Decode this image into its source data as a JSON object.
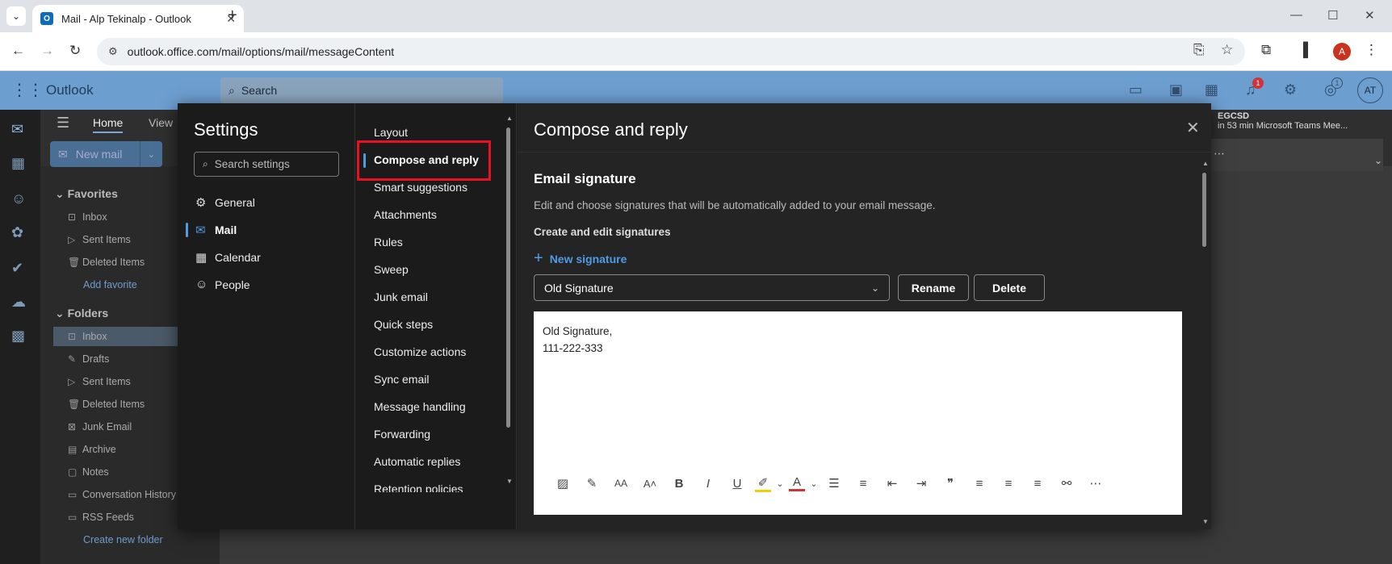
{
  "browser": {
    "tab_title": "Mail - Alp Tekinalp - Outlook",
    "tab_close": "✕",
    "new_tab": "+",
    "url": "outlook.office.com/mail/options/mail/messageContent",
    "profile_initial": "A"
  },
  "outlook_header": {
    "brand": "Outlook",
    "search_placeholder": "Search",
    "notification_badge": "1",
    "tips_badge": "1",
    "avatar_initials": "AT"
  },
  "ribbon": {
    "tabs": [
      "Home",
      "View"
    ],
    "new_mail_label": "New mail"
  },
  "folder_pane": {
    "favorites_label": "Favorites",
    "favorites": [
      "Inbox",
      "Sent Items",
      "Deleted Items"
    ],
    "add_favorite": "Add favorite",
    "folders_label": "Folders",
    "folders": [
      "Inbox",
      "Drafts",
      "Sent Items",
      "Deleted Items",
      "Junk Email",
      "Archive",
      "Notes",
      "Conversation History",
      "RSS Feeds"
    ],
    "create_folder": "Create new folder"
  },
  "meeting": {
    "title": "EGCSD",
    "subtitle": "in 53 min Microsoft Teams Mee..."
  },
  "settings": {
    "title": "Settings",
    "search_placeholder": "Search settings",
    "nav": [
      "General",
      "Mail",
      "Calendar",
      "People"
    ],
    "sub_nav": [
      "Layout",
      "Compose and reply",
      "Smart suggestions",
      "Attachments",
      "Rules",
      "Sweep",
      "Junk email",
      "Quick steps",
      "Customize actions",
      "Sync email",
      "Message handling",
      "Forwarding",
      "Automatic replies",
      "Retention policies"
    ]
  },
  "content": {
    "title": "Compose and reply",
    "section_title": "Email signature",
    "description": "Edit and choose signatures that will be automatically added to your email message.",
    "sub_title": "Create and edit signatures",
    "new_signature": "New signature",
    "selected_signature": "Old Signature",
    "rename_label": "Rename",
    "delete_label": "Delete",
    "signature_lines": [
      "Old Signature,",
      "111-222-333"
    ]
  },
  "colors": {
    "accent": "#4f9be6",
    "highlight": "#e81123",
    "header_bg": "#6d9ed0"
  }
}
